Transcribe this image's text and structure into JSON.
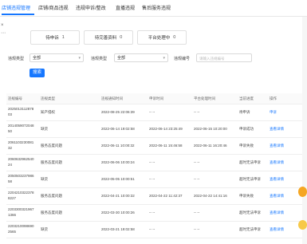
{
  "tabs": [
    {
      "label": "店铺违规管理",
      "active": true
    },
    {
      "label": "店铺/商品违规",
      "active": false
    },
    {
      "label": "违规申诉/整改",
      "active": false
    },
    {
      "label": "直播违规",
      "active": false
    },
    {
      "label": "售后服务违规",
      "active": false
    }
  ],
  "rail": [
    "×",
    "⋯"
  ],
  "summary": [
    {
      "label": "待申诉",
      "count": "1"
    },
    {
      "label": "待完善资料",
      "count": "0"
    },
    {
      "label": "平台处理中",
      "count": "0"
    }
  ],
  "filters": {
    "status_label": "违规类型",
    "status_value": "全部",
    "type_label": "违规类型",
    "type_value": "全部",
    "no_label": "违规编号",
    "no_placeholder": "请输入违规编号",
    "search_label": "搜索"
  },
  "columns": [
    "违规编号",
    "违规类型",
    "违规通知时间",
    "申诉时间",
    "平台处理时间",
    "当前进度",
    "操作"
  ],
  "rows": [
    {
      "id": [
        "2025013112878",
        "03"
      ],
      "type": "知产侵权",
      "notice": "2022-08-25 22:06:39",
      "appeal": "-- --",
      "handled": "-- --",
      "status": "待申诉",
      "action": "申诉"
    },
    {
      "id": [
        "2014059072048",
        "50"
      ],
      "type": "缺货",
      "notice": "2022-06-14 19:02:58",
      "appeal": "2022-06-14 23:25:49",
      "handled": "2022-06-15 10:20:00",
      "status": "申诉成功",
      "action": "查看详情"
    },
    {
      "id": [
        "2061103230081",
        "32"
      ],
      "type": "服务态度问题",
      "notice": "2022-06-11 10:00:32",
      "appeal": "2022-06-11 15:46:58",
      "handled": "2022-06-11 16:20:46",
      "status": "申诉失败",
      "action": "查看详情"
    },
    {
      "id": [
        "2060632962540",
        "24"
      ],
      "type": "服务态度问题",
      "notice": "2022-06-06 10:00:24",
      "appeal": "-- --",
      "handled": "-- --",
      "status": "超时无法申诉",
      "action": "查看详情"
    },
    {
      "id": [
        "2050503237986",
        "58"
      ],
      "type": "缺货",
      "notice": "2022-05-05 10:00:51",
      "appeal": "-- --",
      "handled": "-- --",
      "status": "超时无法申诉",
      "action": "查看详情"
    },
    {
      "id": [
        "2204210322378",
        "8227"
      ],
      "type": "服务态度问题",
      "notice": "2022-04-21 10:00:32",
      "appeal": "2022-04-22 11:42:37",
      "handled": "2022-04-22 14:41:16",
      "status": "申诉失败",
      "action": "查看详情"
    },
    {
      "id": [
        "2203300321967",
        "1366"
      ],
      "type": "服务态度问题",
      "notice": "2022-03-30 10:00:26",
      "appeal": "-- --",
      "handled": "-- --",
      "status": "超时无法申诉",
      "action": "查看详情"
    },
    {
      "id": [
        "2203210098690",
        "2565"
      ],
      "type": "缺货",
      "notice": "2022-03-21 19:02:58",
      "appeal": "-- --",
      "handled": "-- --",
      "status": "超时无法申诉",
      "action": "查看详情"
    }
  ],
  "colors": {
    "accent": "#1677ff",
    "page_bg": "#f0f2f5"
  }
}
